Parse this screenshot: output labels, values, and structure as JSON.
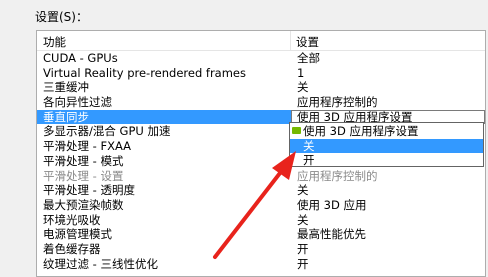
{
  "settings_label": "设置(S)：",
  "columns": {
    "feature": "功能",
    "setting": "设置"
  },
  "rows": [
    {
      "feature": "CUDA - GPUs",
      "value": "全部"
    },
    {
      "feature": "Virtual Reality pre-rendered frames",
      "value": "1"
    },
    {
      "feature": "三重缓冲",
      "value": "关"
    },
    {
      "feature": "各向异性过滤",
      "value": "应用程序控制的"
    },
    {
      "feature": "垂直同步",
      "value": "使用 3D 应用程序设置"
    },
    {
      "feature": "多显示器/混合 GPU 加速",
      "value": ""
    },
    {
      "feature": "平滑处理 - FXAA",
      "value": ""
    },
    {
      "feature": "平滑处理 - 模式",
      "value": ""
    },
    {
      "feature": "平滑处理 - 设置",
      "value": "应用程序控制的"
    },
    {
      "feature": "平滑处理 - 透明度",
      "value": "关"
    },
    {
      "feature": "最大预渲染帧数",
      "value": "使用 3D 应用"
    },
    {
      "feature": "环境光吸收",
      "value": "关"
    },
    {
      "feature": "电源管理模式",
      "value": "最高性能优先"
    },
    {
      "feature": "着色缓存器",
      "value": "开"
    },
    {
      "feature": "纹理过滤 - 三线性优化",
      "value": "开"
    }
  ],
  "dropdown": {
    "options": [
      "使用 3D 应用程序设置",
      "关",
      "开"
    ],
    "selected_index": 1
  },
  "colors": {
    "selection": "#3399ff",
    "arrow": "#e8231c",
    "nvidia": "#76b900"
  }
}
